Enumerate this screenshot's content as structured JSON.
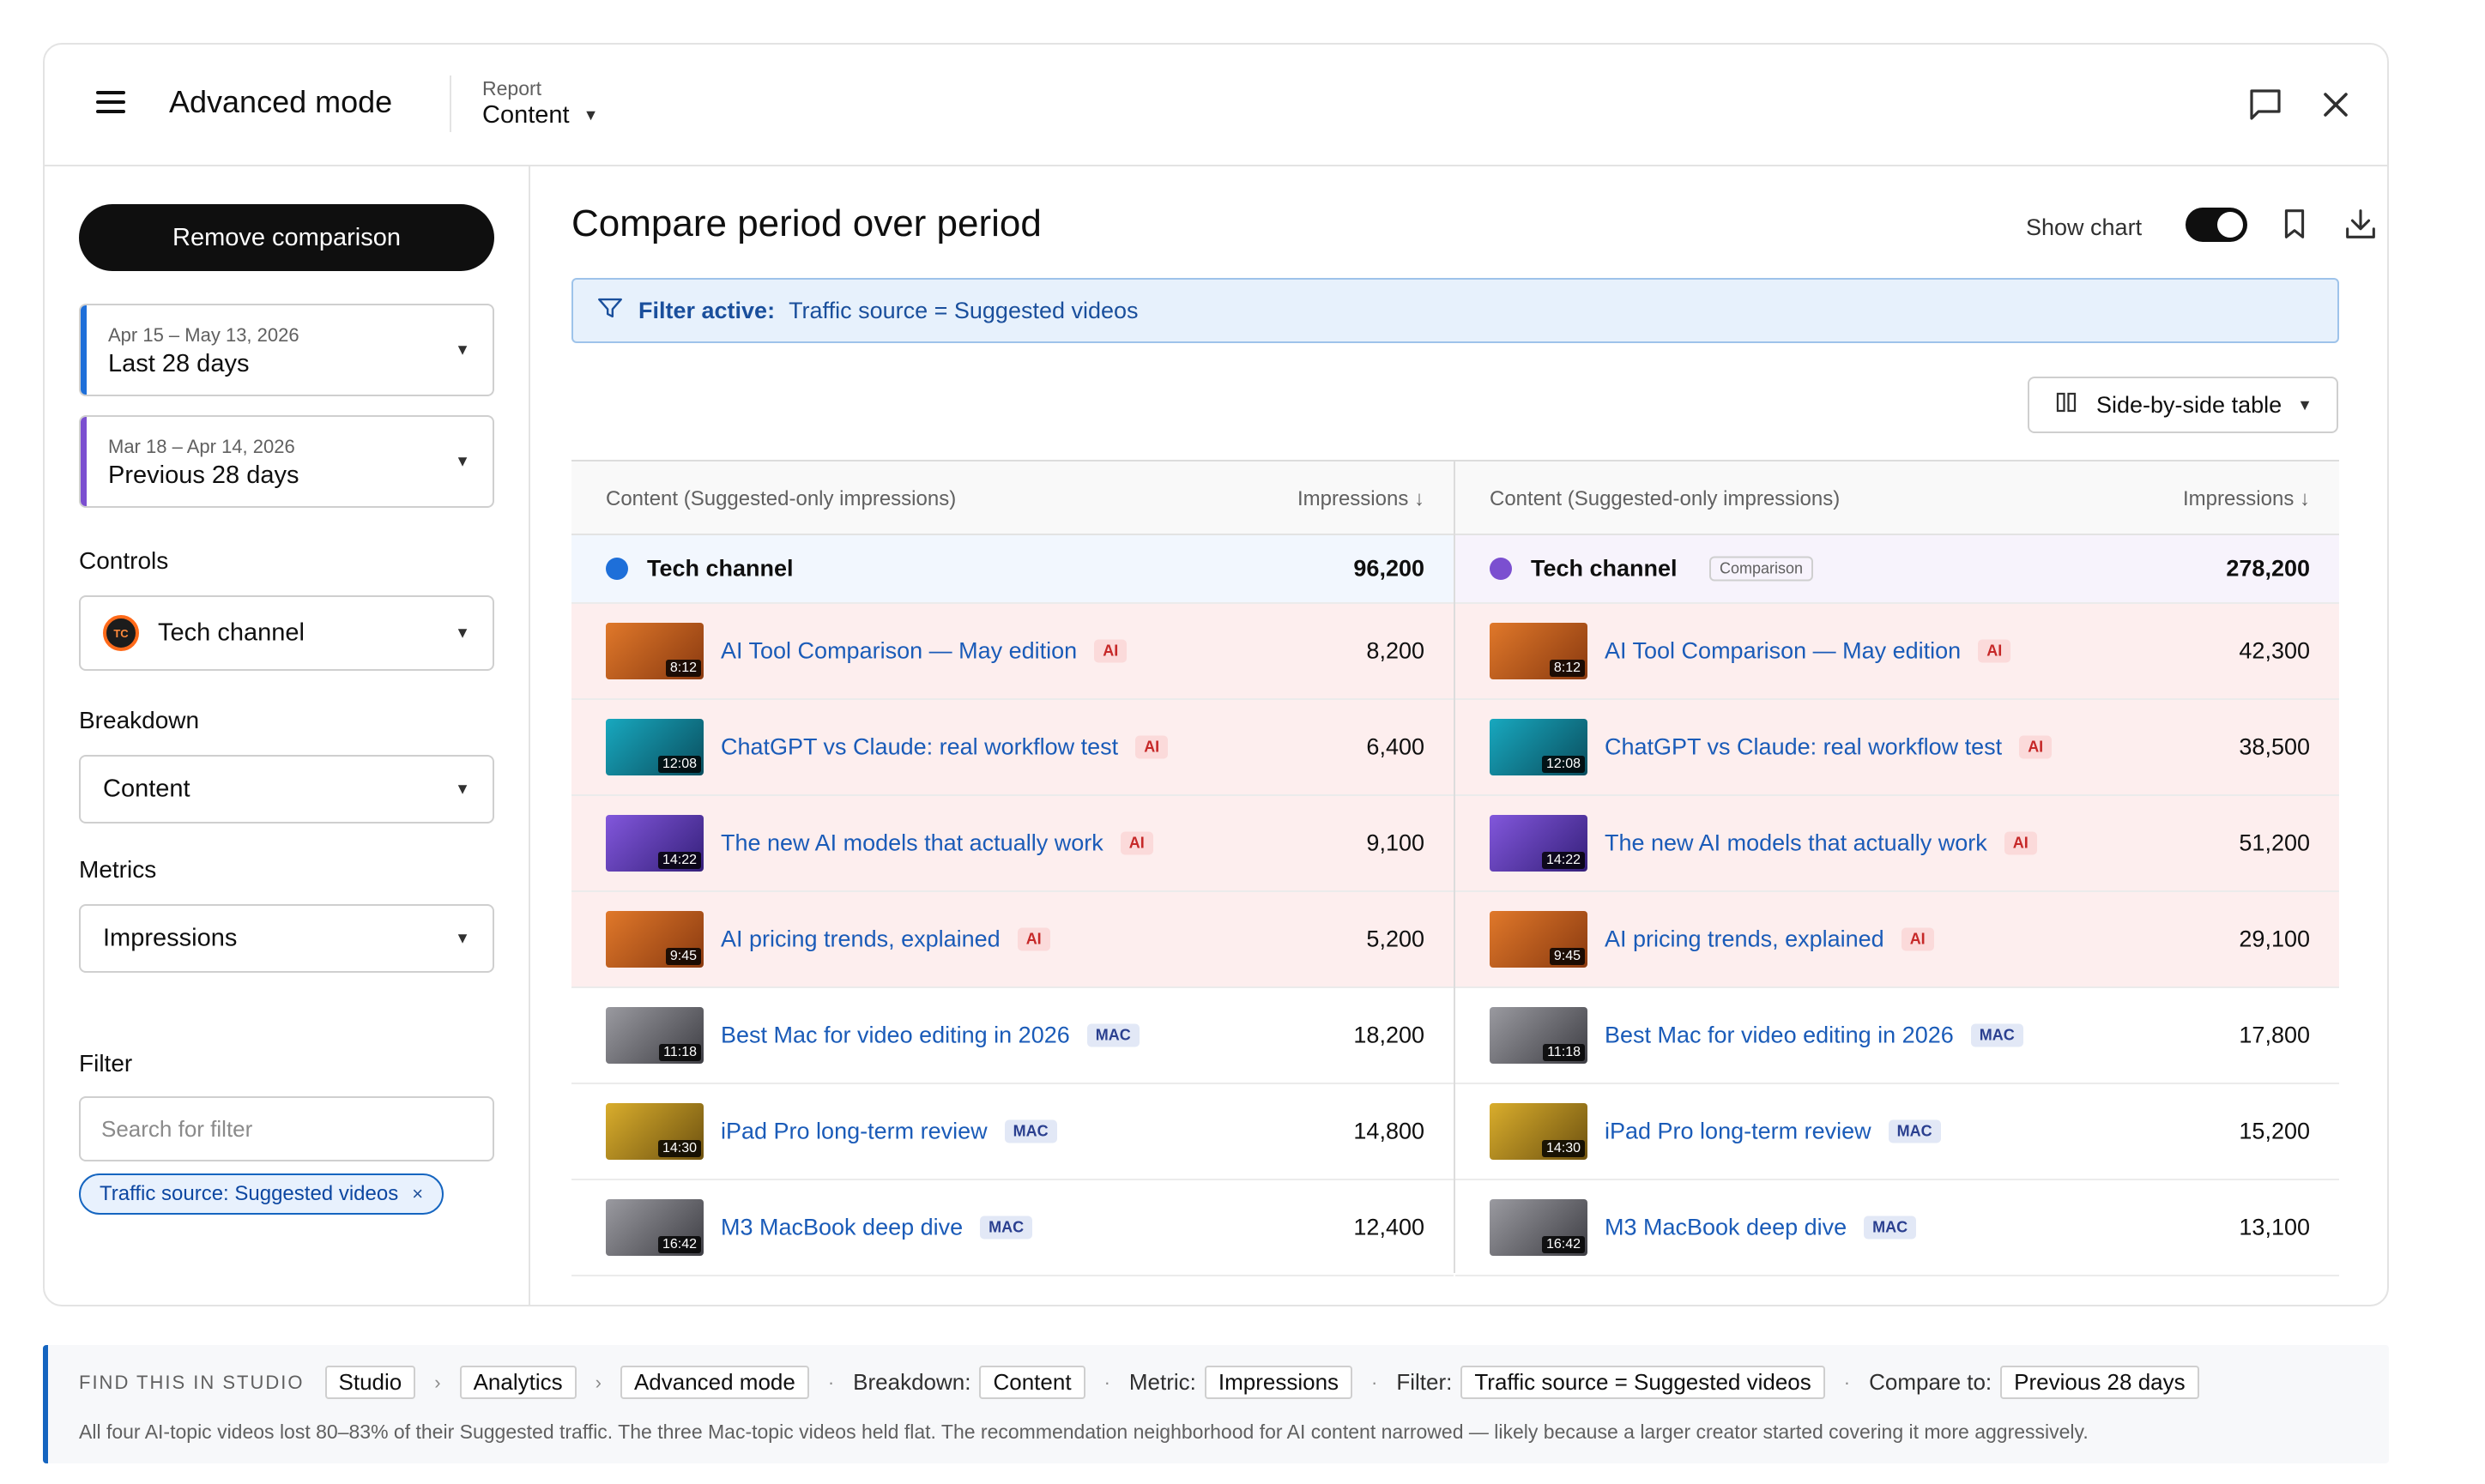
{
  "header": {
    "app_title": "Advanced mode",
    "report_label": "Report",
    "report_value": "Content",
    "icons": [
      "menu-icon",
      "feedback-icon",
      "close-icon"
    ]
  },
  "sidebar": {
    "remove_comparison_label": "Remove comparison",
    "period_primary": {
      "dates": "Apr 15 – May 13, 2026",
      "name": "Last 28 days",
      "color": "#1e6fd9"
    },
    "period_compare": {
      "dates": "Mar 18 – Apr 14, 2026",
      "name": "Previous 28 days",
      "color": "#7b4fd0"
    },
    "controls_label": "Controls",
    "channel_avatar": "TC",
    "channel_value": "Tech channel",
    "breakdown_label": "Breakdown",
    "breakdown_value": "Content",
    "metrics_label": "Metrics",
    "metrics_value": "Impressions",
    "filter_label": "Filter",
    "filter_placeholder": "Search for filter",
    "filter_chip": "Traffic source: Suggested videos",
    "chip_remove": "×"
  },
  "main": {
    "title": "Compare period over period",
    "show_chart_label": "Show chart",
    "show_chart_on": true,
    "filter_banner_label": "Filter active:",
    "filter_banner_value": "Traffic source = Suggested videos",
    "view_select": "Side-by-side table",
    "table_left": {
      "col_content": "Content (Suggested-only impressions)",
      "col_metric": "Impressions ↓",
      "channel_name": "Tech channel",
      "channel_total": "96,200",
      "dot_color": "#1e6fd9"
    },
    "table_right": {
      "col_content": "Content (Suggested-only impressions)",
      "col_metric": "Impressions ↓",
      "channel_name": "Tech channel",
      "comparison_badge": "Comparison",
      "channel_total": "278,200",
      "dot_color": "#7b4fd0"
    },
    "videos": [
      {
        "title": "AI Tool Comparison — May edition",
        "tag": "AI",
        "duration": "8:12",
        "left": "8,200",
        "right": "42,300",
        "thumb": "orange"
      },
      {
        "title": "ChatGPT vs Claude: real workflow test",
        "tag": "AI",
        "duration": "12:08",
        "left": "6,400",
        "right": "38,500",
        "thumb": "teal"
      },
      {
        "title": "The new AI models that actually work",
        "tag": "AI",
        "duration": "14:22",
        "left": "9,100",
        "right": "51,200",
        "thumb": "purple"
      },
      {
        "title": "AI pricing trends, explained",
        "tag": "AI",
        "duration": "9:45",
        "left": "5,200",
        "right": "29,100",
        "thumb": "orange"
      },
      {
        "title": "Best Mac for video editing in 2026",
        "tag": "MAC",
        "duration": "11:18",
        "left": "18,200",
        "right": "17,800",
        "thumb": "gray"
      },
      {
        "title": "iPad Pro long-term review",
        "tag": "MAC",
        "duration": "14:30",
        "left": "14,800",
        "right": "15,200",
        "thumb": "gold"
      },
      {
        "title": "M3 MacBook deep dive",
        "tag": "MAC",
        "duration": "16:42",
        "left": "12,400",
        "right": "13,100",
        "thumb": "gray"
      }
    ]
  },
  "hint": {
    "heading": "FIND THIS IN STUDIO",
    "path": [
      "Studio",
      "Analytics",
      "Advanced mode"
    ],
    "chevron": "›",
    "dot": "·",
    "breakdown_label": "Breakdown:",
    "breakdown_value": "Content",
    "metric_label": "Metric:",
    "metric_value": "Impressions",
    "filter_label": "Filter:",
    "filter_value": "Traffic source = Suggested videos",
    "compare_label": "Compare to:",
    "compare_value": "Previous 28 days",
    "note": "All four AI-topic videos lost 80–83% of their Suggested traffic. The three Mac-topic videos held flat. The recommendation neighborhood for AI content narrowed — likely because a larger creator started covering it more aggressively."
  },
  "colors": {
    "accent": "#1565c0",
    "ai_row_bg": "#fdeeee",
    "link": "#1a5bb8",
    "thumb_orange": "#d9621a",
    "thumb_teal": "#0f8fa6",
    "thumb_purple": "#6d46c9",
    "thumb_gray": "#7a7a80",
    "thumb_gold": "#c99a1e"
  }
}
